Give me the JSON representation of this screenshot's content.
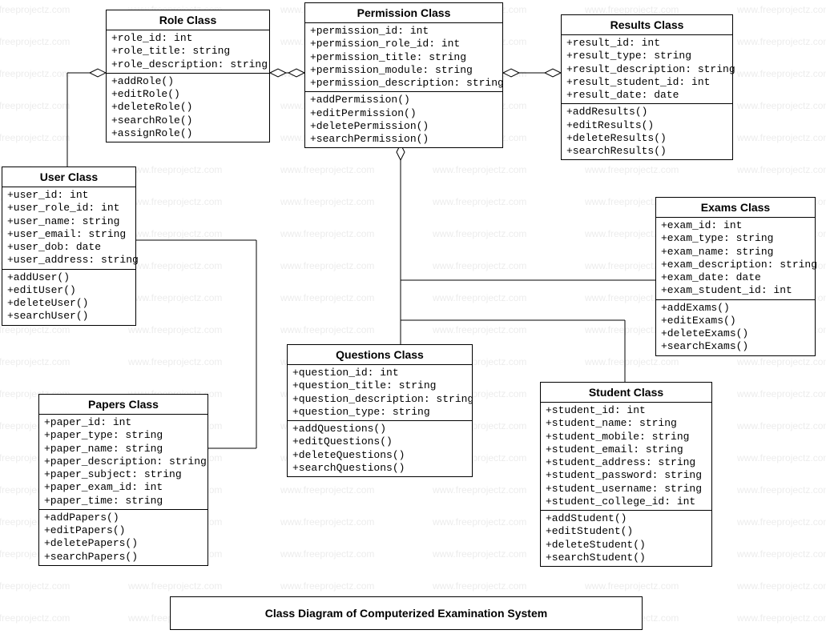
{
  "watermark": "www.freeprojectz.com",
  "caption": "Class Diagram of Computerized Examination System",
  "classes": {
    "role": {
      "title": "Role Class",
      "attrs": [
        "+role_id: int",
        "+role_title: string",
        "+role_description: string"
      ],
      "ops": [
        "+addRole()",
        "+editRole()",
        "+deleteRole()",
        "+searchRole()",
        "+assignRole()"
      ]
    },
    "permission": {
      "title": "Permission Class",
      "attrs": [
        "+permission_id: int",
        "+permission_role_id: int",
        "+permission_title: string",
        "+permission_module: string",
        "+permission_description: string"
      ],
      "ops": [
        "+addPermission()",
        "+editPermission()",
        "+deletePermission()",
        "+searchPermission()"
      ]
    },
    "results": {
      "title": "Results Class",
      "attrs": [
        "+result_id: int",
        "+result_type: string",
        "+result_description: string",
        "+result_student_id: int",
        "+result_date: date"
      ],
      "ops": [
        "+addResults()",
        "+editResults()",
        "+deleteResults()",
        "+searchResults()"
      ]
    },
    "user": {
      "title": "User Class",
      "attrs": [
        "+user_id: int",
        "+user_role_id: int",
        "+user_name: string",
        "+user_email: string",
        "+user_dob: date",
        "+user_address: string"
      ],
      "ops": [
        "+addUser()",
        "+editUser()",
        "+deleteUser()",
        "+searchUser()"
      ]
    },
    "exams": {
      "title": "Exams Class",
      "attrs": [
        "+exam_id: int",
        "+exam_type: string",
        "+exam_name: string",
        "+exam_description: string",
        "+exam_date: date",
        "+exam_student_id: int"
      ],
      "ops": [
        "+addExams()",
        "+editExams()",
        "+deleteExams()",
        "+searchExams()"
      ]
    },
    "questions": {
      "title": "Questions Class",
      "attrs": [
        "+question_id: int",
        "+question_title: string",
        "+question_description: string",
        "+question_type: string"
      ],
      "ops": [
        "+addQuestions()",
        "+editQuestions()",
        "+deleteQuestions()",
        "+searchQuestions()"
      ]
    },
    "papers": {
      "title": "Papers Class",
      "attrs": [
        "+paper_id: int",
        "+paper_type: string",
        "+paper_name: string",
        "+paper_description: string",
        "+paper_subject: string",
        "+paper_exam_id: int",
        "+paper_time: string"
      ],
      "ops": [
        "+addPapers()",
        "+editPapers()",
        "+deletePapers()",
        "+searchPapers()"
      ]
    },
    "student": {
      "title": "Student Class",
      "attrs": [
        "+student_id: int",
        "+student_name: string",
        "+student_mobile: string",
        "+student_email: string",
        "+student_address: string",
        "+student_password: string",
        "+student_username: string",
        "+student_college_id: int"
      ],
      "ops": [
        "+addStudent()",
        "+editStudent()",
        "+deleteStudent()",
        "+searchStudent()"
      ]
    }
  }
}
